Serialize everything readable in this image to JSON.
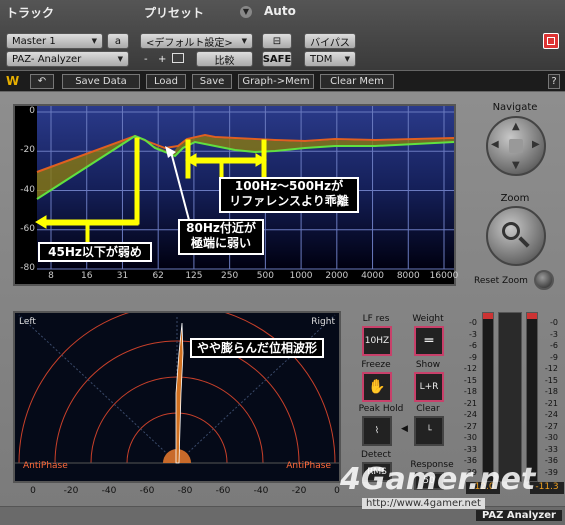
{
  "host": {
    "track_header": "トラック",
    "preset_header": "プリセット",
    "auto_header": "Auto",
    "track_name": "Master 1",
    "track_channel": "a",
    "insert_name": "PAZ- Analyzer",
    "preset_name": "<デフォルト設定>",
    "minus": "-",
    "plus": "+",
    "compare": "比較",
    "safe": "SAFE",
    "bypass": "バイパス",
    "format": "TDM"
  },
  "toolbar": {
    "save_data": "Save Data",
    "load": "Load",
    "save": "Save",
    "graph_mem": "Graph->Mem",
    "clear_mem": "Clear Mem",
    "help": "?"
  },
  "graph": {
    "y_ticks": [
      "0",
      "-20",
      "-40",
      "-60",
      "-80"
    ],
    "x_ticks": [
      "8",
      "16",
      "31",
      "62",
      "125",
      "250",
      "500",
      "1000",
      "2000",
      "4000",
      "8000",
      "16000"
    ]
  },
  "annotations": {
    "low": "45Hz以下が弱め",
    "mid_line1": "80Hz付近が",
    "mid_line2": "極端に弱い",
    "range_line1": "100Hz～500Hzが",
    "range_line2": "リファレンスより乖離",
    "phase": "やや膨らんだ位相波形"
  },
  "navigate": {
    "title": "Navigate",
    "zoom": "Zoom",
    "reset_zoom": "Reset Zoom"
  },
  "stereo": {
    "left": "Left",
    "right": "Right",
    "anti_phase_left": "AntiPhase",
    "anti_phase_right": "AntiPhase",
    "scale": [
      "0",
      "-20",
      "-40",
      "-60",
      "-80",
      "-60",
      "-40",
      "-20",
      "0"
    ]
  },
  "controls": {
    "lf_res": "LF res",
    "lf_res_value": "10HZ",
    "weight": "Weight",
    "freeze": "Freeze",
    "show": "Show",
    "show_value": "L+R",
    "peak_hold": "Peak Hold",
    "clear": "Clear",
    "detect": "Detect",
    "detect_value": "RMS",
    "response": "Response",
    "response_value": "50"
  },
  "meters": {
    "scale": [
      "-0",
      "-3",
      "-6",
      "-9",
      "-12",
      "-15",
      "-18",
      "-21",
      "-24",
      "-27",
      "-30",
      "-33",
      "-36",
      "-39"
    ],
    "left_peak": "-12.0",
    "right_peak": "-11.3"
  },
  "footer": {
    "watermark": "4Gamer.net",
    "url": "http://www.4gamer.net",
    "plugin_name": "PAZ Analyzer"
  }
}
